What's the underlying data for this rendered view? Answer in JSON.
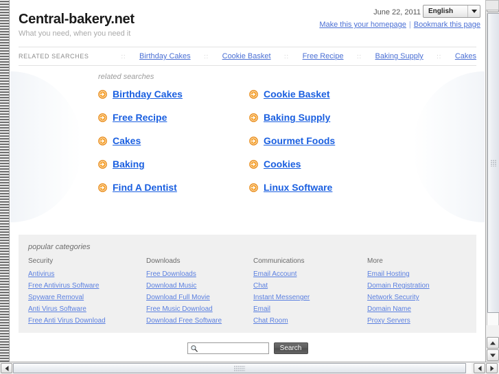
{
  "header": {
    "site_title": "Central-bakery.net",
    "tagline": "What you need, when you need it",
    "date": "June 22, 2011",
    "language": "English",
    "language_icon": "chevron-down-icon",
    "homepage_link": "Make this your homepage",
    "link_separator": "|",
    "bookmark_link": "Bookmark this page"
  },
  "nav": {
    "label": "RELATED SEARCHES",
    "dots": "::",
    "items": [
      "Birthday Cakes",
      "Cookie Basket",
      "Free Recipe",
      "Baking Supply",
      "Cakes"
    ]
  },
  "hero": {
    "heading": "related searches",
    "bullet_icon": "arrow-circle-right-icon",
    "links": [
      "Birthday Cakes",
      "Cookie Basket",
      "Free Recipe",
      "Baking Supply",
      "Cakes",
      "Gourmet Foods",
      "Baking",
      "Cookies",
      "Find A Dentist",
      "Linux Software"
    ]
  },
  "categories": {
    "heading": "popular categories",
    "columns": [
      {
        "title": "Security",
        "links": [
          "Antivirus",
          "Free Antivirus Software",
          "Spyware Removal",
          "Anti Virus Software",
          "Free Anti Virus Download"
        ]
      },
      {
        "title": "Downloads",
        "links": [
          "Free Downloads",
          "Download Music",
          "Download Full Movie",
          "Free Music Download",
          "Download Free Software"
        ]
      },
      {
        "title": "Communications",
        "links": [
          "Email Account",
          "Chat",
          "Instant Messenger",
          "Email",
          "Chat Room"
        ]
      },
      {
        "title": "More",
        "links": [
          "Email Hosting",
          "Domain Registration",
          "Network Security",
          "Domain Name",
          "Proxy Servers"
        ]
      }
    ]
  },
  "search": {
    "icon": "magnifier-icon",
    "value": "",
    "placeholder": "",
    "button_label": "Search"
  },
  "scrollbars": {
    "up_icon": "triangle-up-icon",
    "down_icon": "triangle-down-icon",
    "left_icon": "triangle-left-icon",
    "right_icon": "triangle-right-icon"
  },
  "colors": {
    "link_blue": "#1a5fe0",
    "nav_link_blue": "#4a6fd4",
    "bullet_orange": "#f08c14",
    "panel_gray": "#f0f0f0"
  }
}
